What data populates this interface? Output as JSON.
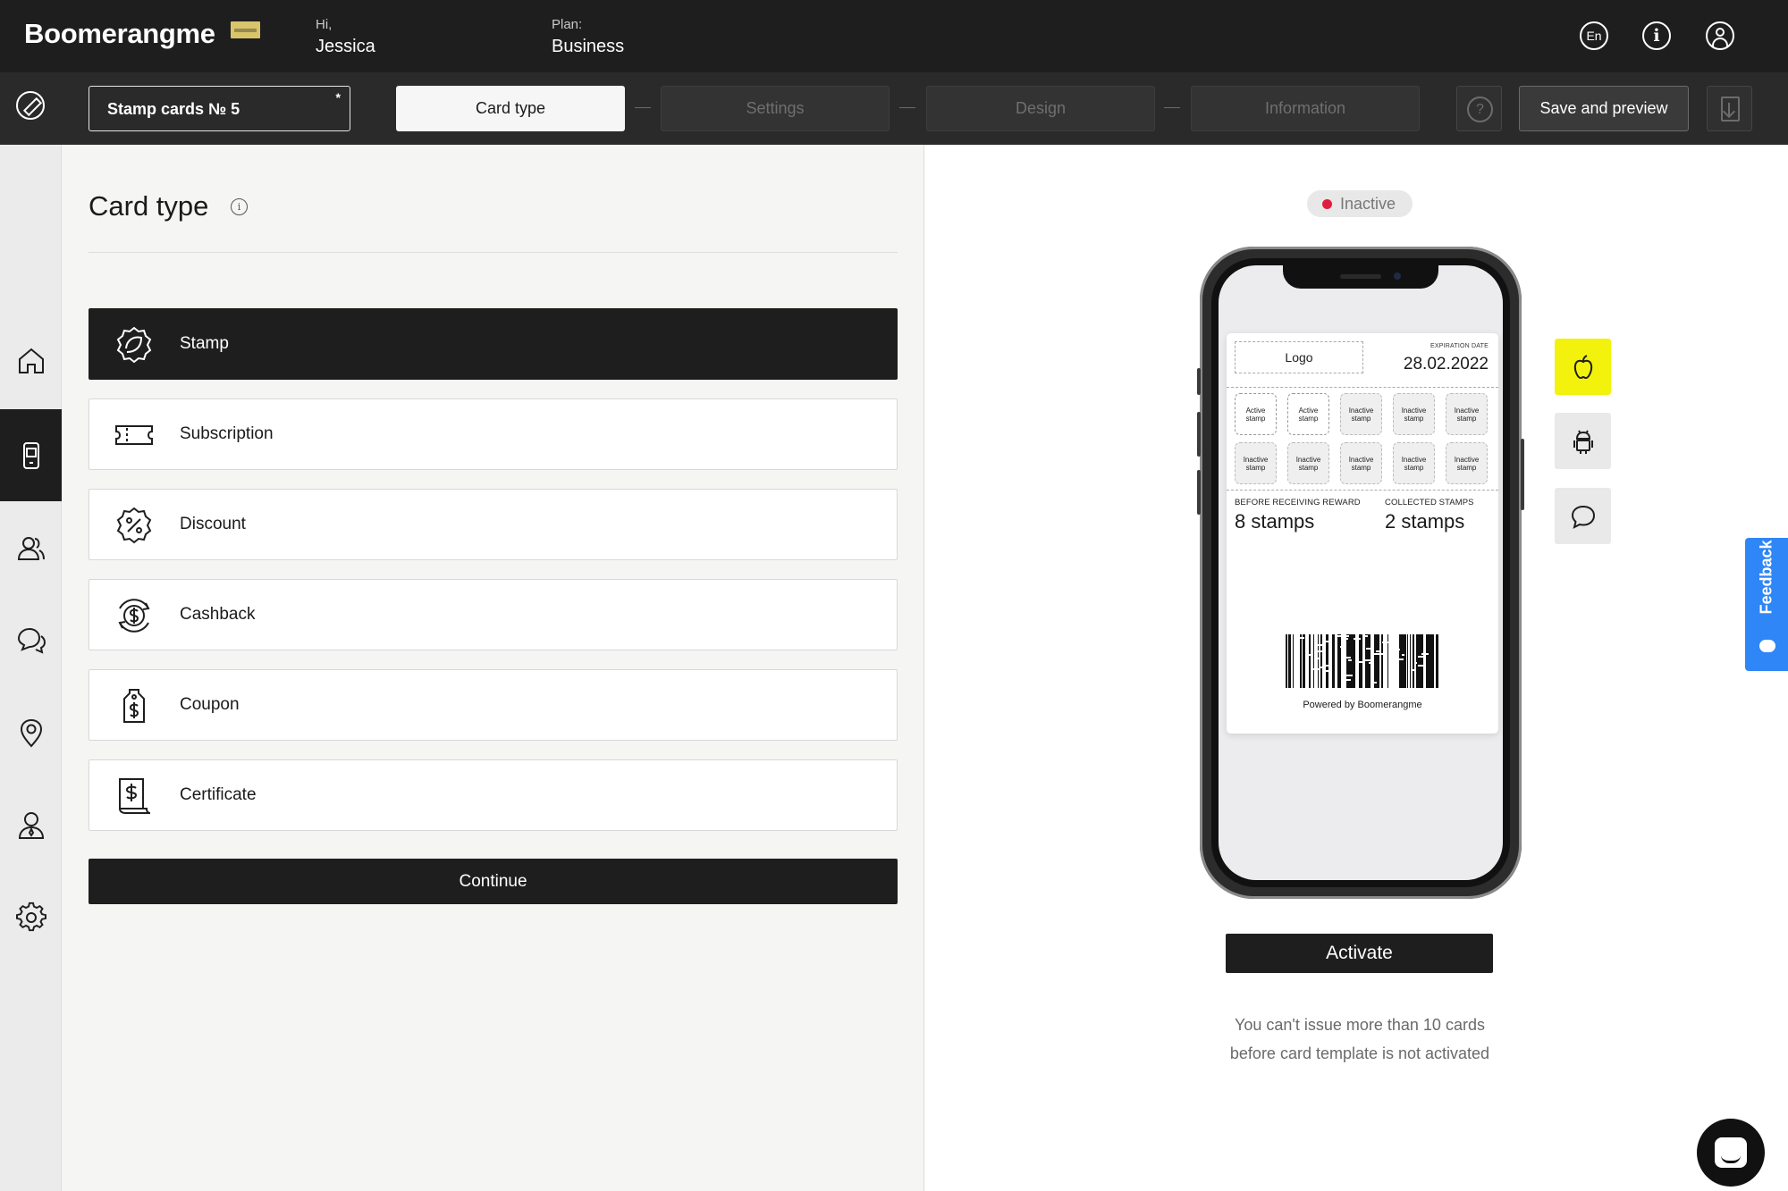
{
  "header": {
    "logo": "Boomerangme",
    "greeting_label": "Hi,",
    "user_name": "Jessica",
    "plan_label": "Plan:",
    "plan_value": "Business",
    "lang_code": "En"
  },
  "toolbar": {
    "card_name": "Stamp cards № 5",
    "required_mark": "*",
    "steps": [
      {
        "label": "Card type",
        "active": true
      },
      {
        "label": "Settings",
        "active": false
      },
      {
        "label": "Design",
        "active": false
      },
      {
        "label": "Information",
        "active": false
      }
    ],
    "help_glyph": "?",
    "save_label": "Save and preview"
  },
  "sidebar": {
    "items": [
      {
        "icon": "home-icon",
        "active": false
      },
      {
        "icon": "cards-icon",
        "active": true
      },
      {
        "icon": "customers-icon",
        "active": false
      },
      {
        "icon": "messages-icon",
        "active": false
      },
      {
        "icon": "location-icon",
        "active": false
      },
      {
        "icon": "manager-icon",
        "active": false
      },
      {
        "icon": "settings-icon",
        "active": false
      }
    ]
  },
  "main": {
    "title": "Card type",
    "card_types": [
      {
        "label": "Stamp",
        "icon": "stamp-icon",
        "selected": true
      },
      {
        "label": "Subscription",
        "icon": "ticket-icon",
        "selected": false
      },
      {
        "label": "Discount",
        "icon": "discount-icon",
        "selected": false
      },
      {
        "label": "Cashback",
        "icon": "cashback-icon",
        "selected": false
      },
      {
        "label": "Coupon",
        "icon": "coupon-tag-icon",
        "selected": false
      },
      {
        "label": "Certificate",
        "icon": "certificate-icon",
        "selected": false
      }
    ],
    "continue_label": "Continue"
  },
  "preview": {
    "status": "Inactive",
    "status_color": "#e11d3f",
    "card": {
      "logo": "Logo",
      "expiration_label": "EXPIRATION DATE",
      "expiration_value": "28.02.2022",
      "stamps": [
        "Active stamp",
        "Active stamp",
        "Inactive stamp",
        "Inactive stamp",
        "Inactive stamp",
        "Inactive stamp",
        "Inactive stamp",
        "Inactive stamp",
        "Inactive stamp",
        "Inactive stamp"
      ],
      "before_reward_label": "BEFORE RECEIVING REWARD",
      "before_reward_value": "8 stamps",
      "collected_label": "COLLECTED STAMPS",
      "collected_value": "2 stamps",
      "powered_by": "Powered by Boomerangme"
    },
    "platforms": [
      {
        "icon": "apple-icon",
        "active": true
      },
      {
        "icon": "android-icon",
        "active": false
      },
      {
        "icon": "chat-icon",
        "active": false
      }
    ],
    "activate_label": "Activate",
    "note_line1": "You can't issue more than 10 cards",
    "note_line2": "before card template is not activated"
  },
  "feedback_label": "Feedback",
  "accent_colors": {
    "apple_button": "#f2f20c",
    "feedback_tab": "#2f86f6"
  }
}
